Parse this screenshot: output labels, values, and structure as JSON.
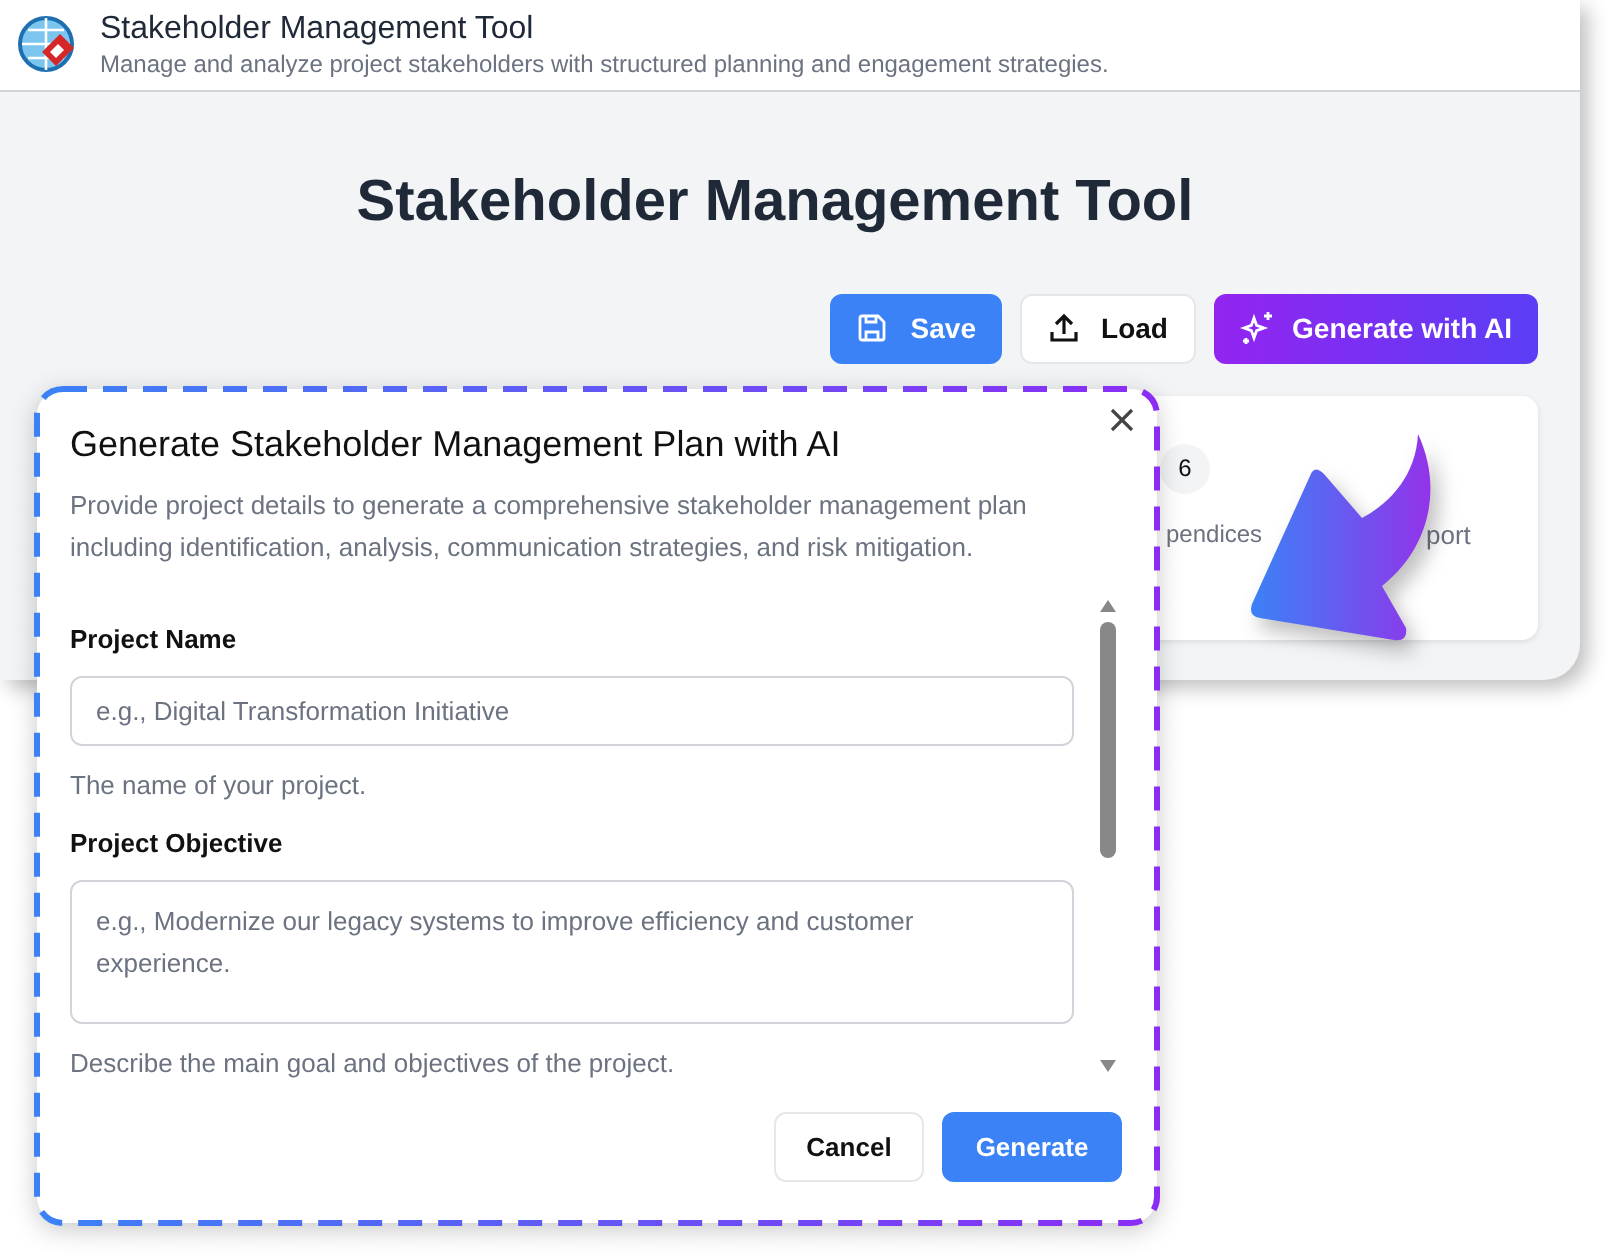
{
  "window": {
    "title": "Stakeholder Management Tool",
    "subtitle": "Manage and analyze project stakeholders with structured planning and engagement strategies."
  },
  "page": {
    "heading": "Stakeholder Management Tool",
    "toolbar": [
      {
        "label": "Save",
        "kind": "primary"
      },
      {
        "label": "Load",
        "kind": "outline"
      },
      {
        "label": "Generate with AI",
        "kind": "ai"
      }
    ],
    "card": {
      "step": "6",
      "texts": [
        "pendices",
        "port"
      ]
    }
  },
  "dialog": {
    "title": "Generate Stakeholder Management Plan with AI",
    "description": "Provide project details to generate a comprehensive stakeholder management plan including identification, analysis, communication strategies, and risk mitigation.",
    "fields": [
      {
        "label": "Project Name",
        "kind": "input",
        "placeholder": "e.g., Digital Transformation Initiative",
        "help": "The name of your project."
      },
      {
        "label": "Project Objective",
        "kind": "textarea",
        "placeholder": "e.g., Modernize our legacy systems to improve efficiency and customer experience.",
        "help": "Describe the main goal and objectives of the project."
      }
    ],
    "buttons": [
      {
        "label": "Cancel",
        "kind": "outline"
      },
      {
        "label": "Generate",
        "kind": "primary"
      }
    ]
  }
}
